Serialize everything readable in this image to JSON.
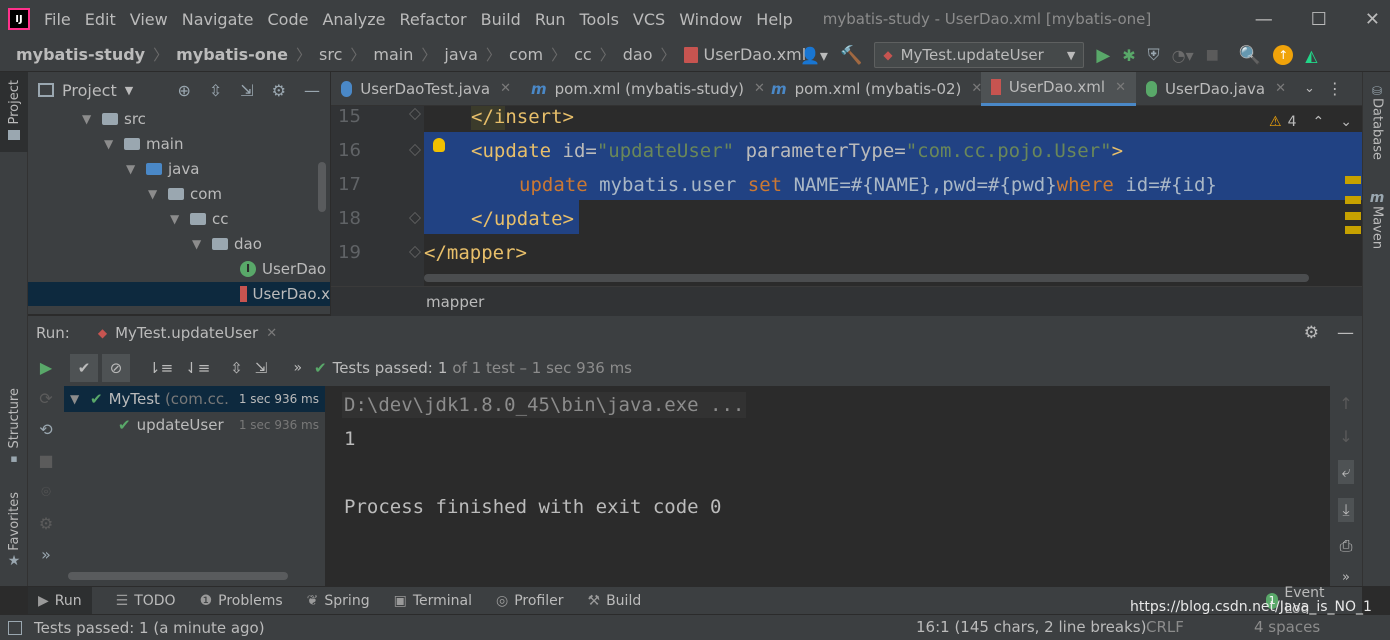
{
  "titlebar": {
    "menu": [
      "File",
      "Edit",
      "View",
      "Navigate",
      "Code",
      "Analyze",
      "Refactor",
      "Build",
      "Run",
      "Tools",
      "VCS",
      "Window",
      "Help"
    ],
    "window_title": "mybatis-study - UserDao.xml [mybatis-one]"
  },
  "navbar": {
    "breadcrumbs": [
      "mybatis-study",
      "mybatis-one",
      "src",
      "main",
      "java",
      "com",
      "cc",
      "dao",
      "UserDao.xml"
    ],
    "run_config": "MyTest.updateUser"
  },
  "project": {
    "title": "Project",
    "tree": [
      {
        "label": "src",
        "depth": 0
      },
      {
        "label": "main",
        "depth": 1
      },
      {
        "label": "java",
        "depth": 2
      },
      {
        "label": "com",
        "depth": 3
      },
      {
        "label": "cc",
        "depth": 4
      },
      {
        "label": "dao",
        "depth": 5
      },
      {
        "label": "UserDao",
        "depth": 6
      },
      {
        "label": "UserDao.x",
        "depth": 6
      }
    ]
  },
  "sidebar": {
    "left_top": "Project",
    "left_mid": "Structure",
    "left_bottom": "Favorites",
    "right_top": "Database",
    "right_mid": "Maven"
  },
  "tabs": [
    {
      "label": "UserDaoTest.java",
      "active": false
    },
    {
      "label": "pom.xml (mybatis-study)",
      "active": false
    },
    {
      "label": "pom.xml (mybatis-02)",
      "active": false
    },
    {
      "label": "UserDao.xml",
      "active": true
    },
    {
      "label": "UserDao.java",
      "active": false
    }
  ],
  "editor": {
    "line_numbers": [
      "15",
      "16",
      "17",
      "18",
      "19"
    ],
    "warning_count": "4",
    "code": {
      "l15": "</insert>",
      "l16_open": "<update",
      "l16_attr1": " id=",
      "l16_val1": "\"updateUser\"",
      "l16_attr2": " parameterType=",
      "l16_val2": "\"com.cc.pojo.User\"",
      "l16_close": ">",
      "l17_kw1": "update",
      "l17_t1": " mybatis.user ",
      "l17_kw2": "set",
      "l17_t2": " NAME=#{NAME},pwd=#{pwd}",
      "l17_kw3": "where",
      "l17_t3": " id=#{id}",
      "l18": "</update>",
      "l19": "</mapper>"
    },
    "breadcrumb": "mapper"
  },
  "run": {
    "label": "Run:",
    "tab": "MyTest.updateUser",
    "status": "Tests passed:",
    "status_count": "1",
    "status_detail": "of 1 test – 1 sec 936 ms",
    "tree": [
      {
        "name": "MyTest",
        "pkg": "(com.cc.",
        "time": "1 sec 936 ms"
      },
      {
        "name": "updateUser",
        "pkg": "",
        "time": "1 sec 936 ms"
      }
    ],
    "console": [
      "D:\\dev\\jdk1.8.0_45\\bin\\java.exe ...",
      "1",
      "",
      "Process finished with exit code 0"
    ]
  },
  "bottom_tabs": [
    "Run",
    "TODO",
    "Problems",
    "Spring",
    "Terminal",
    "Profiler",
    "Build"
  ],
  "event_log": "Event Log",
  "event_count": "1",
  "statusbar": {
    "left": "Tests passed: 1 (a minute ago)",
    "position": "16:1 (145 chars, 2 line breaks)",
    "encoding": "CRLF",
    "indent": "4 spaces",
    "watermark": "https://blog.csdn.net/Java_is_NO_1"
  },
  "colors": {
    "accent": "#4a88c7",
    "selection": "#214283",
    "green": "#59a869",
    "panel": "#3c3f41",
    "editor": "#2b2b2b"
  }
}
